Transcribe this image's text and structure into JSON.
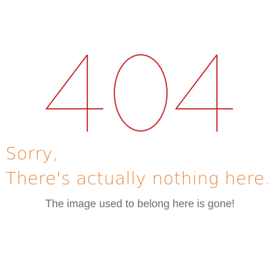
{
  "error": {
    "code": "404",
    "code_color": "#c8232b"
  },
  "message": {
    "line1": "Sorry,",
    "line2": "There's actually nothing here.",
    "color": "#e8883f"
  },
  "detail": {
    "text": "The image used to belong here is gone!",
    "color": "#6a6a6a"
  }
}
